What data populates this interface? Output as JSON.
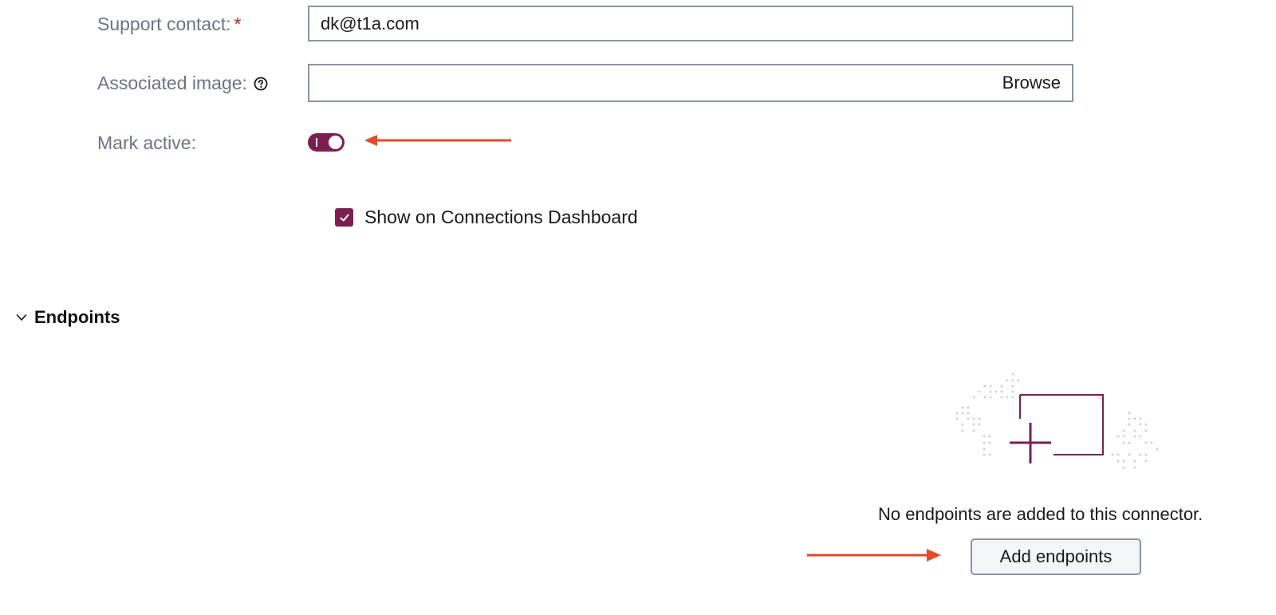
{
  "form": {
    "support_contact": {
      "label": "Support contact:",
      "required_mark": "*",
      "value": "dk@t1a.com"
    },
    "associated_image": {
      "label": "Associated image:",
      "browse_label": "Browse",
      "help_icon": "question-circle-icon"
    },
    "mark_active": {
      "label": "Mark active:",
      "checked": true
    },
    "show_on_dashboard": {
      "label": "Show on Connections Dashboard",
      "checked": true
    }
  },
  "endpoints": {
    "title": "Endpoints",
    "chevron_icon": "chevron-down-icon",
    "empty_message": "No endpoints are added to this connector.",
    "add_button_label": "Add endpoints",
    "illustration_icon": "add-window-icon"
  },
  "colors": {
    "accent": "#7a1f4f",
    "annotation_arrow": "#e04b2a",
    "label_gray": "#6b7385",
    "required": "#b42318"
  }
}
